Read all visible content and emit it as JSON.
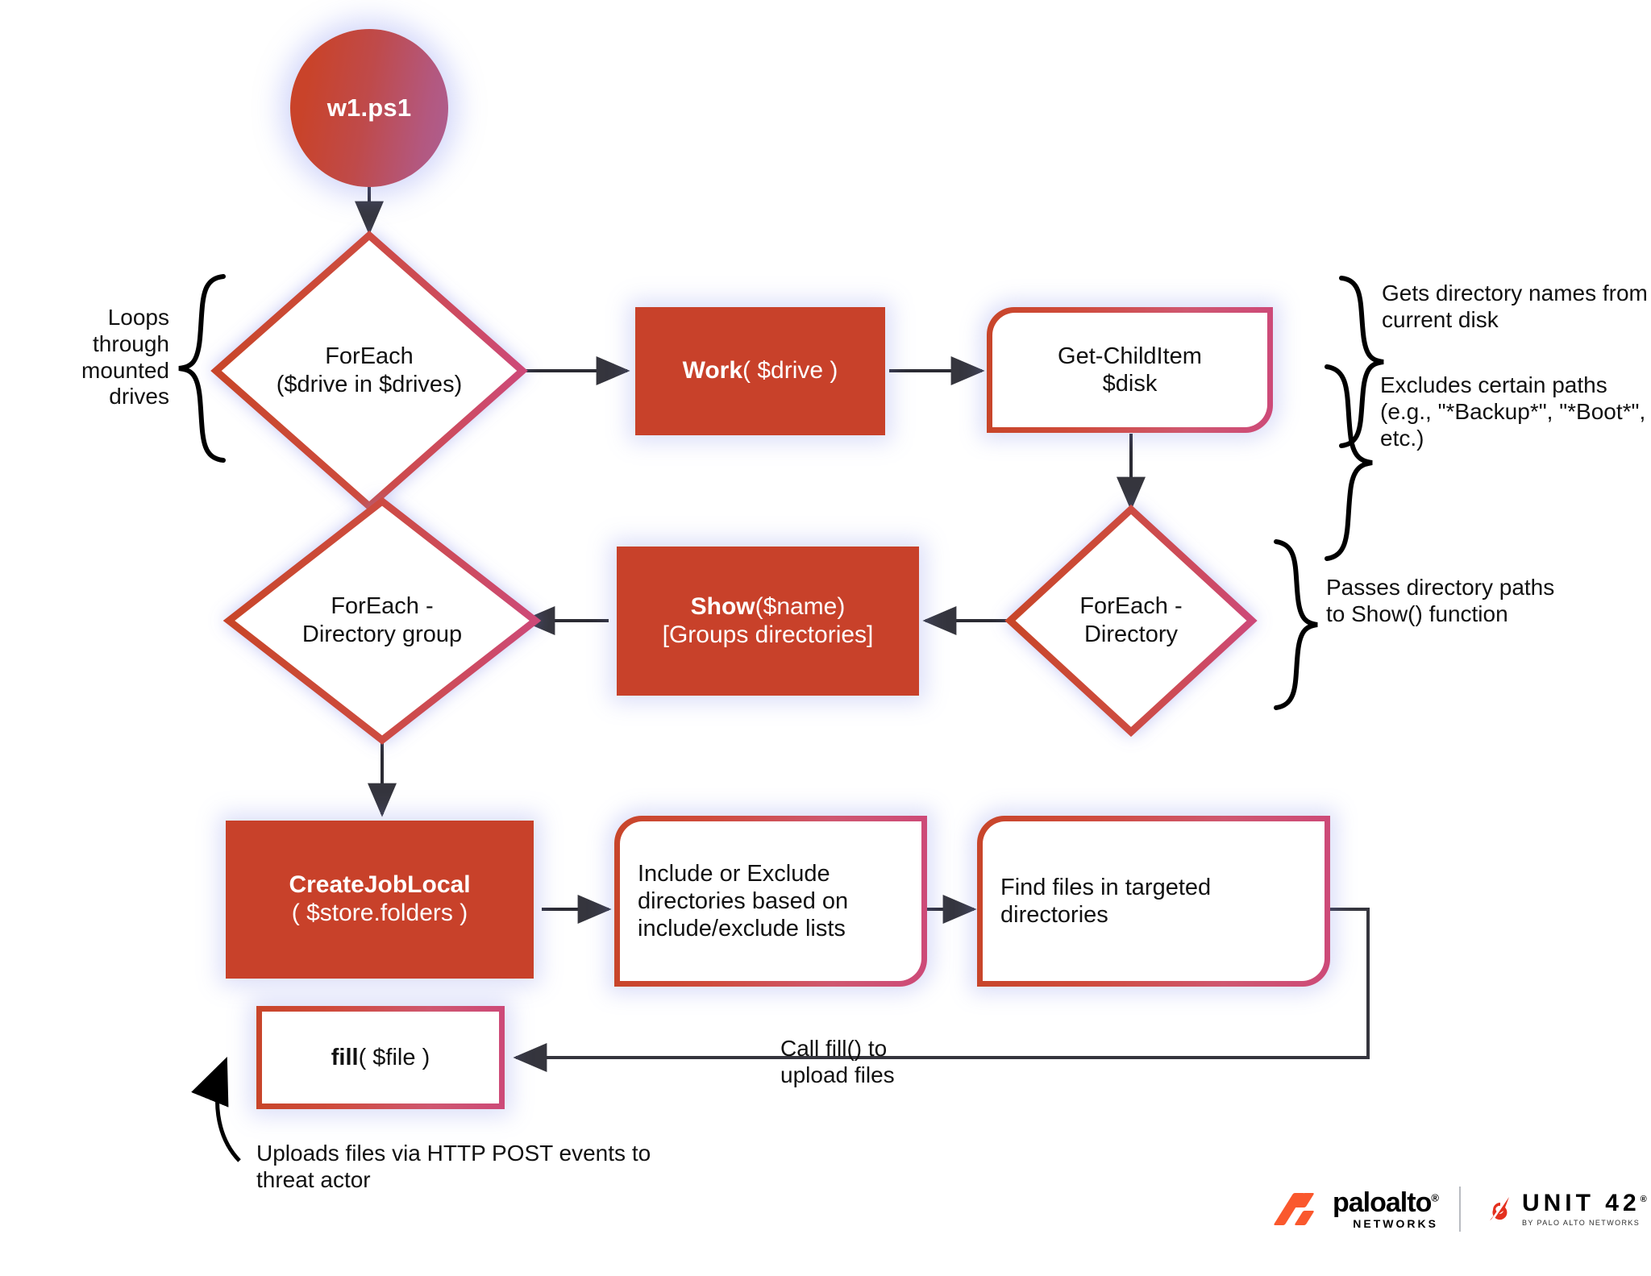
{
  "diagram": {
    "title": "w1.ps1 PowerShell exfiltration flow",
    "colors": {
      "solid_fill": "#c8412a",
      "gradient_start": "#c8452a",
      "gradient_end": "#cd4a78",
      "glow": "#7d87eb",
      "arrow": "#2b2b33",
      "text": "#111111"
    }
  },
  "nodes": {
    "start": {
      "label": "w1.ps1"
    },
    "foreach_drive": {
      "line1": "ForEach",
      "line2": "($drive in $drives)"
    },
    "work": {
      "fn": "Work",
      "args": "( $drive )"
    },
    "get_childitem": {
      "line1": "Get-ChildItem",
      "line2": "$disk"
    },
    "foreach_directory": {
      "line1": "ForEach -",
      "line2": "Directory"
    },
    "show": {
      "fn": "Show",
      "args": "($name)",
      "line2": "[Groups directories]"
    },
    "foreach_directory_group": {
      "line1": "ForEach -",
      "line2": "Directory group"
    },
    "create_job_local": {
      "fn": "CreateJobLocal",
      "args": "( $store.folders )"
    },
    "include_exclude": {
      "text": "Include or Exclude directories based on include/exclude lists"
    },
    "find_files": {
      "text": "Find files in targeted directories"
    },
    "fill": {
      "fn": "fill",
      "args": "( $file )"
    }
  },
  "annotations": {
    "loops_through": "Loops through mounted drives",
    "gets_dir_names": "Gets directory names from current disk",
    "excludes_paths": "Excludes certain paths (e.g., \"*Backup*\", \"*Boot*\", etc.)",
    "passes_paths": "Passes directory paths to Show() function",
    "call_fill": "Call fill() to upload files",
    "uploads_files": "Uploads files via HTTP POST events to threat actor"
  },
  "footer": {
    "paloalto_word": "paloalto",
    "paloalto_reg": "®",
    "paloalto_sub": "NETWORKS",
    "unit42_word": "UNIT 42",
    "unit42_reg": "®",
    "unit42_sub": "BY PALO ALTO NETWORKS"
  }
}
